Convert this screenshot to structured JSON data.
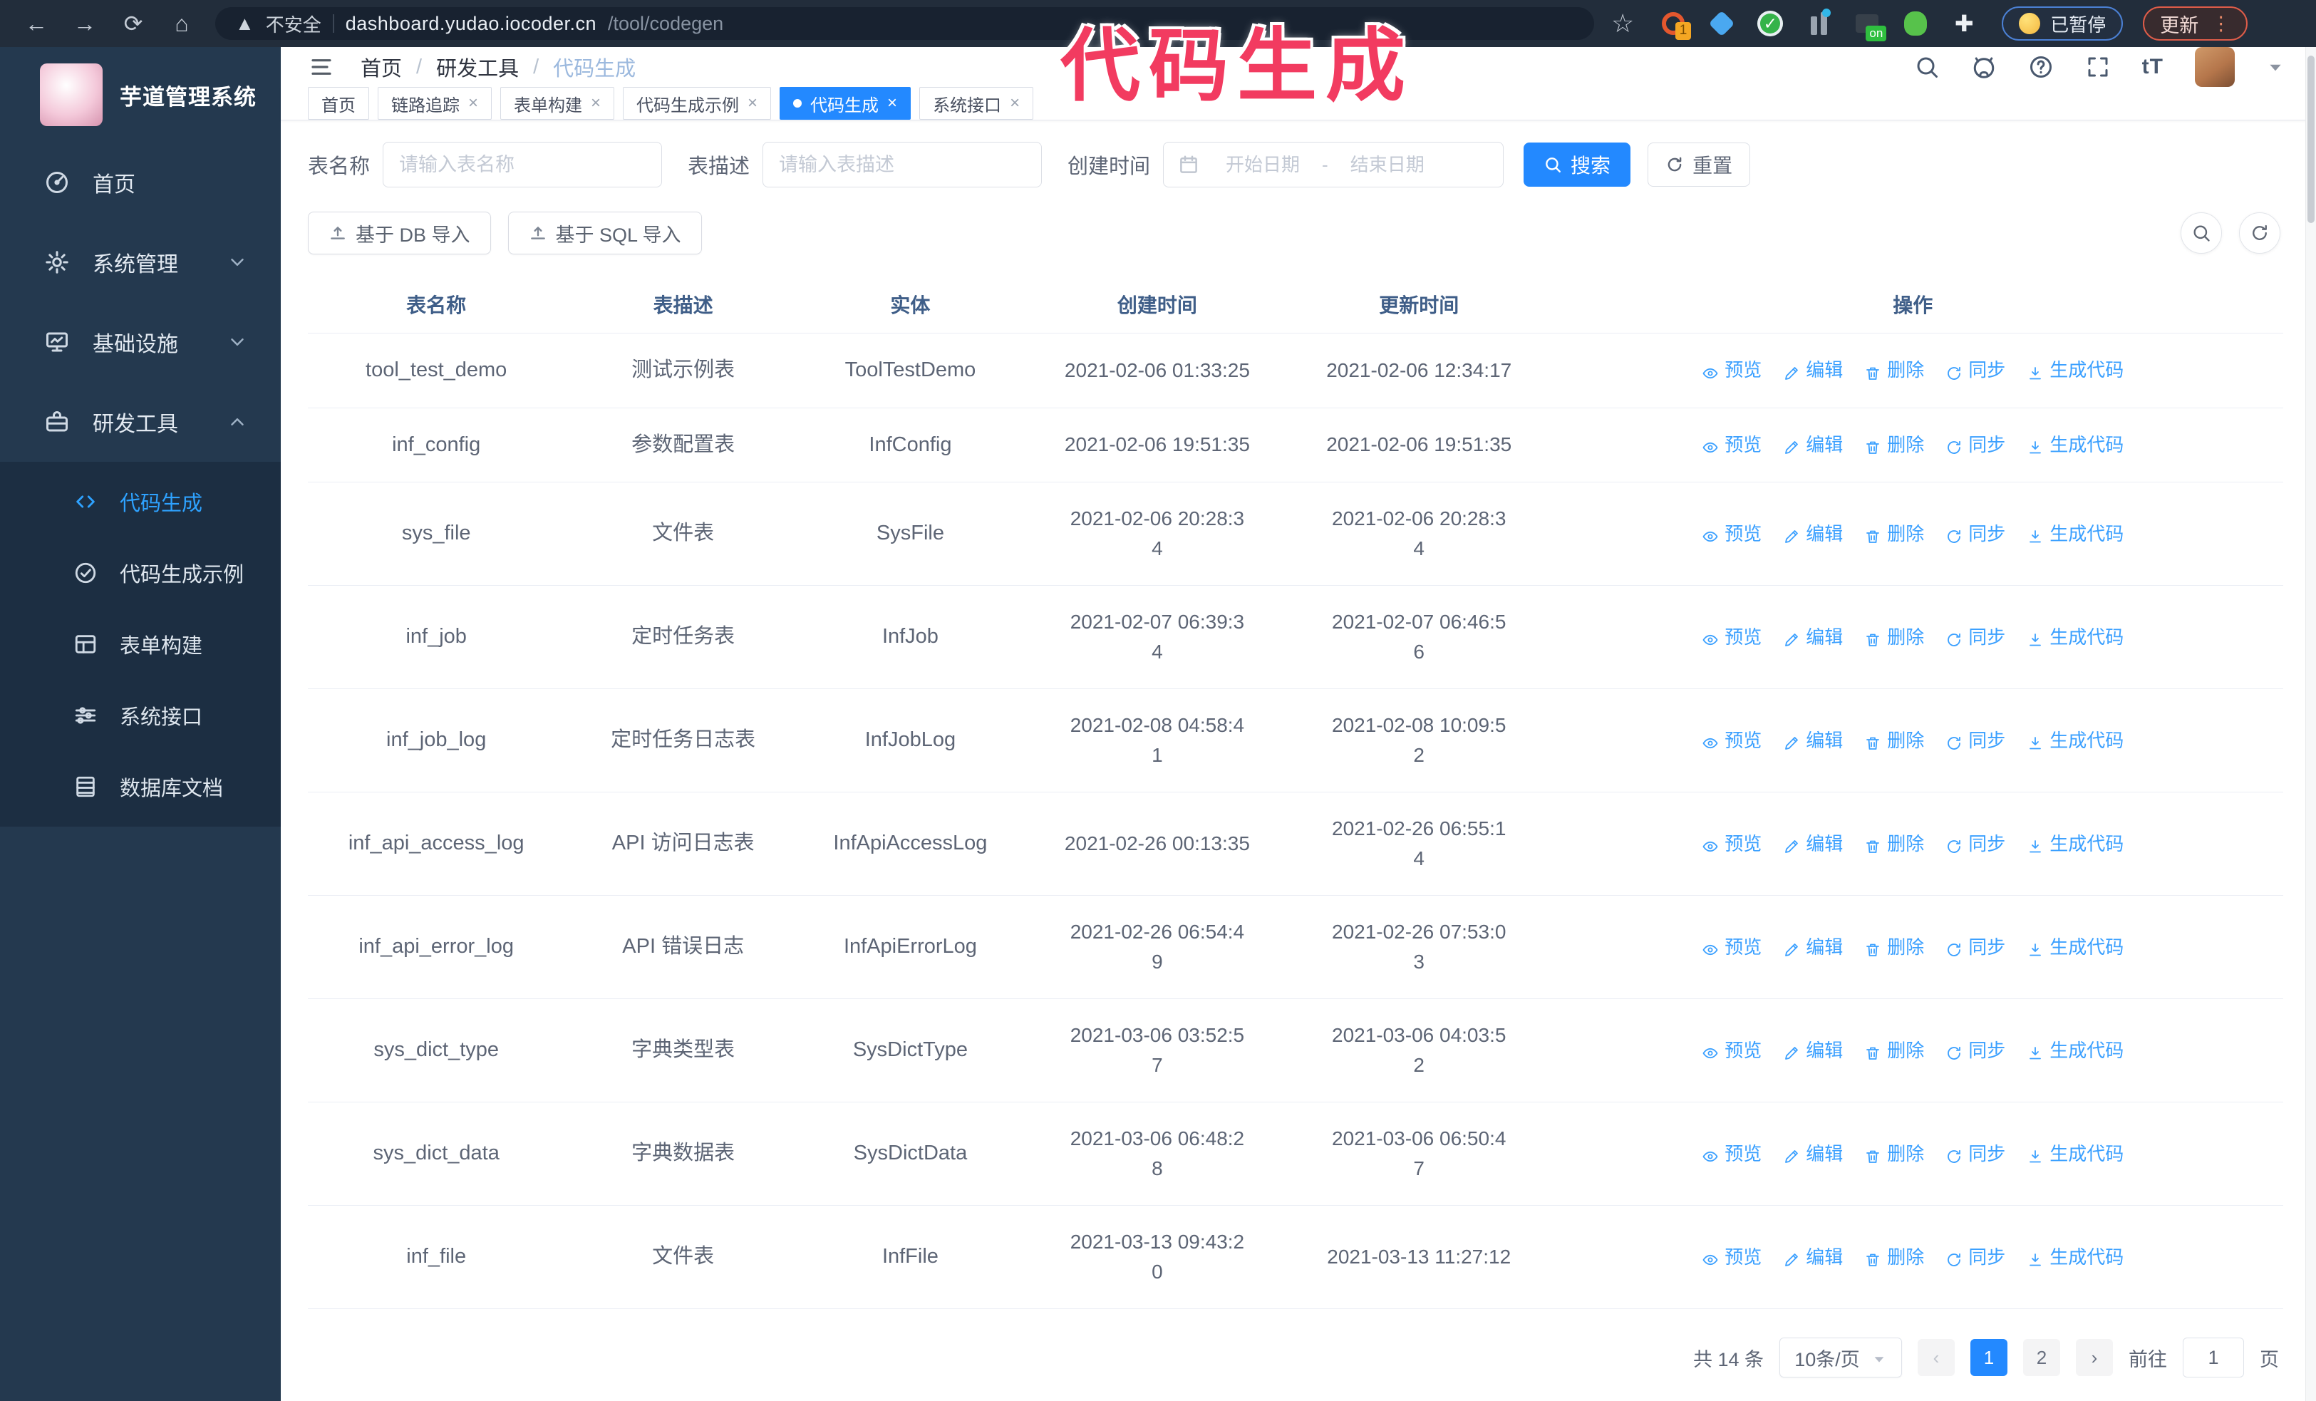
{
  "browser": {
    "security_label": "不安全",
    "url_host": "dashboard.yudao.iocoder.cn",
    "url_path": "/tool/codegen",
    "extension_badge": "1",
    "extension_on_badge": "on",
    "paused_badge": "已暂停",
    "update_button": "更新"
  },
  "overlay": {
    "title": "代码生成",
    "color": "#f23b60"
  },
  "sidebar": {
    "app_title": "芋道管理系统",
    "items": [
      {
        "label": "首页",
        "icon": "dashboard-icon",
        "chevron": null
      },
      {
        "label": "系统管理",
        "icon": "gear-icon",
        "chevron": "down"
      },
      {
        "label": "基础设施",
        "icon": "infra-icon",
        "chevron": "down"
      },
      {
        "label": "研发工具",
        "icon": "tools-icon",
        "chevron": "up"
      }
    ],
    "submenu": [
      {
        "label": "代码生成",
        "icon": "code-icon",
        "active": true
      },
      {
        "label": "代码生成示例",
        "icon": "example-icon",
        "active": false
      },
      {
        "label": "表单构建",
        "icon": "form-icon",
        "active": false
      },
      {
        "label": "系统接口",
        "icon": "api-icon",
        "active": false
      },
      {
        "label": "数据库文档",
        "icon": "dbdoc-icon",
        "active": false
      }
    ]
  },
  "navbar": {
    "breadcrumb": [
      "首页",
      "研发工具",
      "代码生成"
    ]
  },
  "tabs": [
    {
      "label": "首页",
      "closable": false,
      "active": false
    },
    {
      "label": "链路追踪",
      "closable": true,
      "active": false
    },
    {
      "label": "表单构建",
      "closable": true,
      "active": false
    },
    {
      "label": "代码生成示例",
      "closable": true,
      "active": false
    },
    {
      "label": "代码生成",
      "closable": true,
      "active": true
    },
    {
      "label": "系统接口",
      "closable": true,
      "active": false
    }
  ],
  "search": {
    "name_label": "表名称",
    "name_placeholder": "请输入表名称",
    "desc_label": "表描述",
    "desc_placeholder": "请输入表描述",
    "time_label": "创建时间",
    "start_placeholder": "开始日期",
    "range_separator": "-",
    "end_placeholder": "结束日期",
    "search_label": "搜索",
    "reset_label": "重置"
  },
  "toolbar": {
    "db_import_label": "基于 DB 导入",
    "sql_import_label": "基于 SQL 导入"
  },
  "table": {
    "headers": [
      "表名称",
      "表描述",
      "实体",
      "创建时间",
      "更新时间",
      "操作"
    ],
    "actions": [
      "预览",
      "编辑",
      "删除",
      "同步",
      "生成代码"
    ],
    "rows": [
      {
        "name": "tool_test_demo",
        "desc": "测试示例表",
        "entity": "ToolTestDemo",
        "created": "2021-02-06 01:33:25",
        "updated": "2021-02-06 12:34:17"
      },
      {
        "name": "inf_config",
        "desc": "参数配置表",
        "entity": "InfConfig",
        "created": "2021-02-06 19:51:35",
        "updated": "2021-02-06 19:51:35"
      },
      {
        "name": "sys_file",
        "desc": "文件表",
        "entity": "SysFile",
        "created": "2021-02-06 20:28:3\n4",
        "updated": "2021-02-06 20:28:3\n4"
      },
      {
        "name": "inf_job",
        "desc": "定时任务表",
        "entity": "InfJob",
        "created": "2021-02-07 06:39:3\n4",
        "updated": "2021-02-07 06:46:5\n6"
      },
      {
        "name": "inf_job_log",
        "desc": "定时任务日志表",
        "entity": "InfJobLog",
        "created": "2021-02-08 04:58:4\n1",
        "updated": "2021-02-08 10:09:5\n2"
      },
      {
        "name": "inf_api_access_log",
        "desc": "API 访问日志表",
        "entity": "InfApiAccessLog",
        "created": "2021-02-26 00:13:35",
        "updated": "2021-02-26 06:55:1\n4"
      },
      {
        "name": "inf_api_error_log",
        "desc": "API 错误日志",
        "entity": "InfApiErrorLog",
        "created": "2021-02-26 06:54:4\n9",
        "updated": "2021-02-26 07:53:0\n3"
      },
      {
        "name": "sys_dict_type",
        "desc": "字典类型表",
        "entity": "SysDictType",
        "created": "2021-03-06 03:52:5\n7",
        "updated": "2021-03-06 04:03:5\n2"
      },
      {
        "name": "sys_dict_data",
        "desc": "字典数据表",
        "entity": "SysDictData",
        "created": "2021-03-06 06:48:2\n8",
        "updated": "2021-03-06 06:50:4\n7"
      },
      {
        "name": "inf_file",
        "desc": "文件表",
        "entity": "InfFile",
        "created": "2021-03-13 09:43:2\n0",
        "updated": "2021-03-13 11:27:12"
      }
    ]
  },
  "pagination": {
    "total": "共 14 条",
    "page_size": "10条/页",
    "pages": [
      "1",
      "2"
    ],
    "active_page": "1",
    "goto_label": "前往",
    "goto_value": "1",
    "page_unit": "页"
  }
}
